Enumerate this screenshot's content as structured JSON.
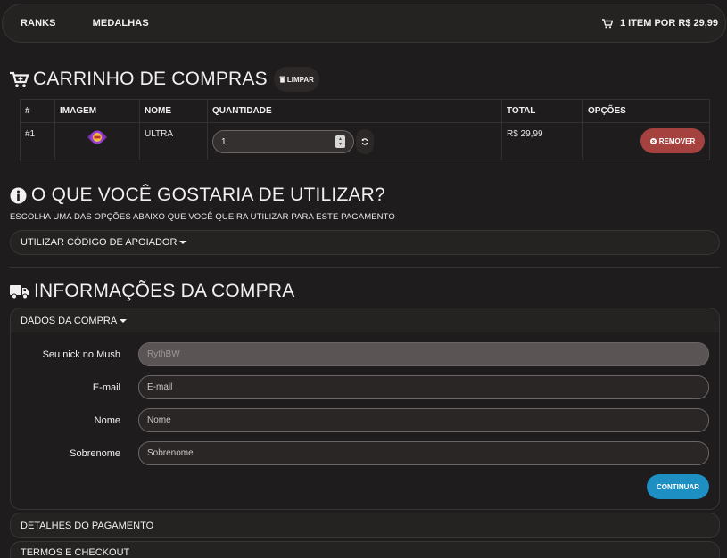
{
  "nav": {
    "links": [
      "RANKS",
      "MEDALHAS"
    ],
    "cart_summary": "1 ITEM POR R$ 29,99"
  },
  "cart": {
    "title": "CARRINHO DE COMPRAS",
    "clear_label": "LIMPAR",
    "columns": [
      "#",
      "IMAGEM",
      "NOME",
      "QUANTIDADE",
      "TOTAL",
      "OPÇÕES"
    ],
    "rows": [
      {
        "index": "#1",
        "name": "ULTRA",
        "quantity": "1",
        "total": "R$ 29,99",
        "remove_label": "REMOVER"
      }
    ]
  },
  "usage": {
    "title": "O QUE VOCÊ GOSTARIA DE UTILIZAR?",
    "subtitle": "ESCOLHA UMA DAS OPÇÕES ABAIXO QUE VOCÊ QUEIRA UTILIZAR PARA ESTE PAGAMENTO",
    "supporter_code_label": "UTILIZAR CÓDIGO DE APOIADOR"
  },
  "purchase": {
    "title": "INFORMAÇÕES DA COMPRA",
    "panel_title": "DADOS DA COMPRA",
    "fields": [
      {
        "label": "Seu nick no Mush",
        "value": "RythBW"
      },
      {
        "label": "E-mail",
        "placeholder": "E-mail"
      },
      {
        "label": "Nome",
        "placeholder": "Nome"
      },
      {
        "label": "Sobrenome",
        "placeholder": "Sobrenome"
      }
    ],
    "continue_label": "CONTINUAR",
    "payment_details_label": "DETALHES DO PAGAMENTO",
    "terms_label": "TERMOS E CHECKOUT"
  },
  "colors": {
    "background": "#1e1c1c",
    "danger": "#a5423f",
    "primary": "#1d8fc2"
  },
  "icons": [
    "cart-icon",
    "cart-plus-icon",
    "trash-icon",
    "refresh-icon",
    "times-circle-icon",
    "info-circle-icon",
    "truck-icon",
    "caret-down-icon"
  ]
}
